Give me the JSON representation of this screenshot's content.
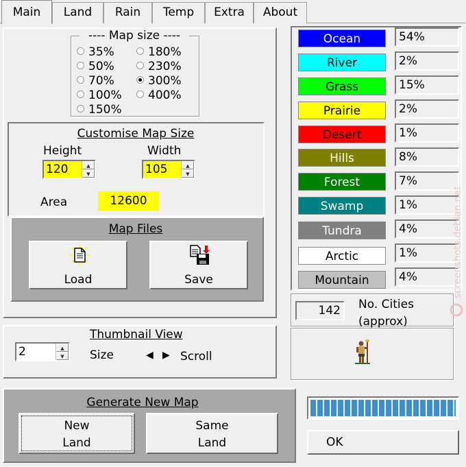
{
  "tabs": [
    "Main",
    "Land",
    "Rain",
    "Temp",
    "Extra",
    "About"
  ],
  "map_size": {
    "title": "----  Map size  ----",
    "options": [
      {
        "label": "35%",
        "selected": false
      },
      {
        "label": "50%",
        "selected": false
      },
      {
        "label": "70%",
        "selected": false
      },
      {
        "label": "100%",
        "selected": false
      },
      {
        "label": "150%",
        "selected": false
      },
      {
        "label": "180%",
        "selected": false
      },
      {
        "label": "230%",
        "selected": false
      },
      {
        "label": "300%",
        "selected": true
      },
      {
        "label": "400%",
        "selected": false
      }
    ]
  },
  "customise": {
    "title": "Customise Map Size",
    "height_label": "Height",
    "height_value": "120",
    "width_label": "Width",
    "width_value": "105",
    "area_label": "Area",
    "area_value": "12600"
  },
  "map_files": {
    "title": "Map Files",
    "load": "Load",
    "save": "Save"
  },
  "thumbnail": {
    "title": "Thumbnail View",
    "size_value": "2",
    "size_label": "Size",
    "scroll_label": "Scroll"
  },
  "generate": {
    "title": "Generate New Map",
    "new_land": "New\nLand",
    "same_land": "Same\nLand"
  },
  "terrain": [
    {
      "name": "Ocean",
      "pct": "54%",
      "bg": "#0000ff",
      "fg": "#ffffff"
    },
    {
      "name": "River",
      "pct": "2%",
      "bg": "#00ffff",
      "fg": "#000000"
    },
    {
      "name": "Grass",
      "pct": "15%",
      "bg": "#00ff00",
      "fg": "#000000"
    },
    {
      "name": "Prairie",
      "pct": "2%",
      "bg": "#ffff00",
      "fg": "#000000"
    },
    {
      "name": "Desert",
      "pct": "1%",
      "bg": "#ff0000",
      "fg": "#000000"
    },
    {
      "name": "Hills",
      "pct": "8%",
      "bg": "#808000",
      "fg": "#ffffff"
    },
    {
      "name": "Forest",
      "pct": "7%",
      "bg": "#008000",
      "fg": "#ffffff"
    },
    {
      "name": "Swamp",
      "pct": "1%",
      "bg": "#008080",
      "fg": "#ffffff"
    },
    {
      "name": "Tundra",
      "pct": "4%",
      "bg": "#808080",
      "fg": "#ffffff"
    },
    {
      "name": "Arctic",
      "pct": "1%",
      "bg": "#ffffff",
      "fg": "#000000"
    },
    {
      "name": "Mountain",
      "pct": "4%",
      "bg": "#c0c0c0",
      "fg": "#000000"
    }
  ],
  "cities": {
    "value": "142",
    "label": "No. Cities\n(approx)"
  },
  "progress": 1.0,
  "ok": "OK",
  "watermark": "screenshots.debian.net"
}
